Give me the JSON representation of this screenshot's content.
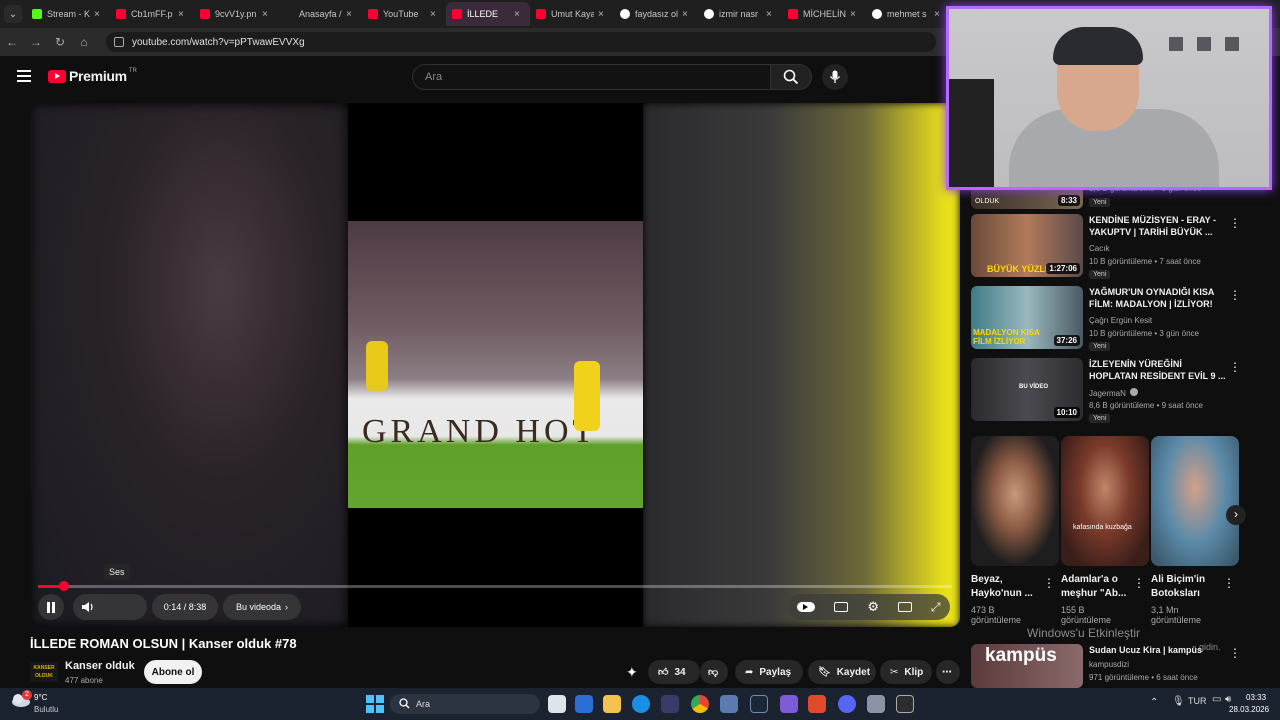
{
  "browser": {
    "tabs": [
      {
        "title": "Stream - K",
        "icon": "kick-icon",
        "color": "#53fc18"
      },
      {
        "title": "Cb1mFF.p",
        "icon": "youtube-icon",
        "color": "#ff0033"
      },
      {
        "title": "9cvV1y.pn",
        "icon": "youtube-icon",
        "color": "#ff0033"
      },
      {
        "title": "Anasayfa /",
        "icon": "x-icon",
        "color": "#ffffff"
      },
      {
        "title": "YouTube",
        "icon": "youtube-icon",
        "color": "#ff0033"
      },
      {
        "title": "İLLEDE",
        "icon": "youtube-icon",
        "color": "#ff0033",
        "active": true
      },
      {
        "title": "Umut Kaya",
        "icon": "youtube-icon",
        "color": "#ff0033"
      },
      {
        "title": "faydasız ol",
        "icon": "google-icon",
        "color": "#ffffff"
      },
      {
        "title": "izmir nasr",
        "icon": "google-icon",
        "color": "#ffffff"
      },
      {
        "title": "MİCHELİN",
        "icon": "youtube-icon",
        "color": "#ff0033"
      },
      {
        "title": "mehmet s",
        "icon": "google-icon",
        "color": "#ffffff"
      }
    ],
    "url": "youtube.com/watch?v=pPTwawEVVXg"
  },
  "yt_header": {
    "logo_text": "Premium",
    "country": "TR",
    "search_placeholder": "Ara"
  },
  "player": {
    "banner_text": "GRAND HOT",
    "tooltip": "Ses",
    "time": "0:14 / 8:38",
    "chapter": "Bu videoda",
    "progress": 0.028
  },
  "video": {
    "title": "İLLEDE ROMAN OLSUN | Kanser olduk #78",
    "channel": "Kanser olduk",
    "channel_logo_text": "KANSER OLDUK",
    "subscribers": "477 abone",
    "subscribe_label": "Abone ol",
    "likes": "34",
    "share": "Paylaş",
    "save": "Kaydet",
    "clip": "Klip"
  },
  "recommendations": [
    {
      "duration": "8:33",
      "meta": "1,6 B görüntüleme • 3 gün önce",
      "badge": "Yeni",
      "thumb_text": "OLDUK"
    },
    {
      "title": "KENDİNE MÜZİSYEN - ERAY - YAKUPTV | TARİHİ BÜYÜK ...",
      "channel": "Cacık",
      "meta": "10 B görüntüleme • 7 saat önce",
      "badge": "Yeni",
      "duration": "1:27:06",
      "thumb_text": "BÜYÜK YÜZLE"
    },
    {
      "title": "YAĞMUR'UN OYNADIĞI KISA FİLM: MADALYON | İZLİYOR!",
      "channel": "Çağrı Ergün Kesit",
      "meta": "10 B görüntüleme • 3 gün önce",
      "badge": "Yeni",
      "duration": "37:26",
      "thumb_text": "MADALYON KISA FİLM İZLİYOR"
    },
    {
      "title": "İZLEYENİN YÜREĞİNİ HOPLATAN RESİDENT EVİL 9 ...",
      "channel": "JagermaN",
      "meta": "8,6 B görüntüleme • 9 saat önce",
      "badge": "Yeni",
      "duration": "10:10",
      "thumb_text": "BU VİDEO"
    }
  ],
  "shorts": [
    {
      "title": "Beyaz, Hayko'nun ...",
      "views": "473 B görüntüleme"
    },
    {
      "title": "Adamlar'a o meşhur \"Ab...",
      "views": "155 B görüntüleme",
      "thumb_text": "kafasında kuzbağa"
    },
    {
      "title": "Ali Biçim'in Botoksları",
      "views": "3,1 Mn görüntüleme"
    }
  ],
  "last_rec": {
    "title": "Sudan Ucuz Kira | kampüs",
    "channel": "kampusdizi",
    "meta": "971 görüntüleme • 6 saat önce",
    "thumb_text": "kampüs"
  },
  "watermark": {
    "line1": "Windows'u Etkinleştir",
    "line2": "gidin."
  },
  "taskbar": {
    "weather_temp": "9°C",
    "weather_desc": "Bulutlu",
    "search": "Ara",
    "time": "03:33",
    "date": "28.03.2026",
    "lang": "TUR",
    "notif": "2"
  }
}
